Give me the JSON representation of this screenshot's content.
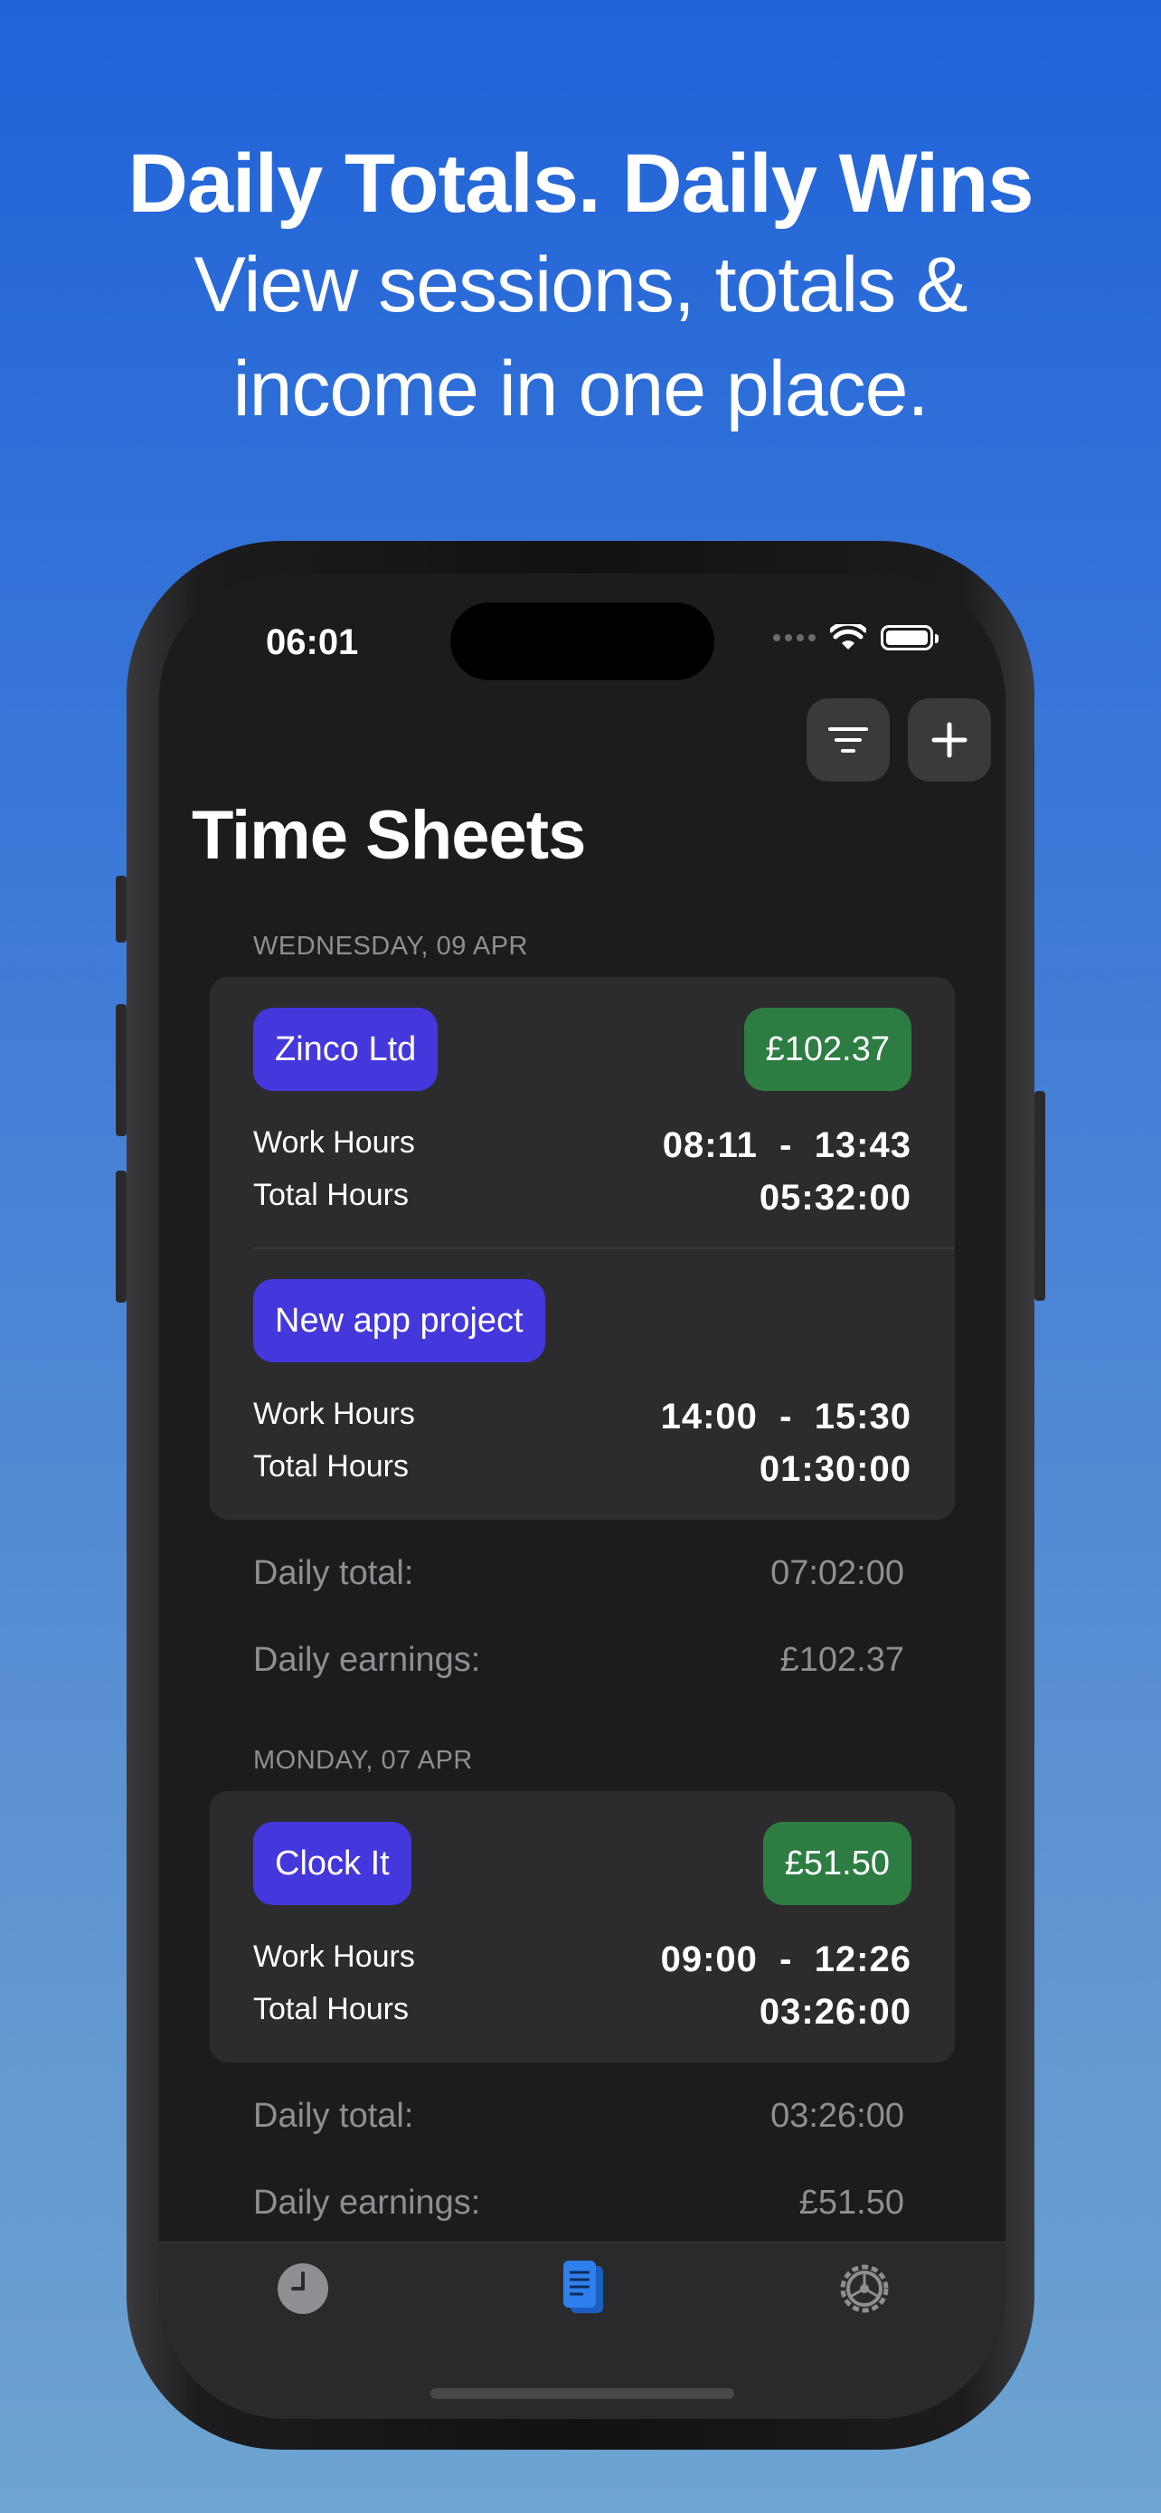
{
  "headline": {
    "line1": "Daily Totals. Daily Wins",
    "line2": "View sessions, totals &",
    "line3": "income in one place."
  },
  "status_bar": {
    "time": "06:01"
  },
  "toolbar": {
    "filter_icon": "filter-lines-icon",
    "add_icon": "plus-icon"
  },
  "page_title": "Time Sheets",
  "days": [
    {
      "header": "WEDNESDAY, 09 APR",
      "entries": [
        {
          "project": "Zinco Ltd",
          "amount": "£102.37",
          "work_label": "Work Hours",
          "work_start": "08:11",
          "work_end": "13:43",
          "total_label": "Total Hours",
          "total": "05:32:00"
        },
        {
          "project": "New app project",
          "amount": "",
          "work_label": "Work Hours",
          "work_start": "14:00",
          "work_end": "15:30",
          "total_label": "Total Hours",
          "total": "01:30:00"
        }
      ],
      "daily_total_label": "Daily total:",
      "daily_total": "07:02:00",
      "daily_earnings_label": "Daily earnings:",
      "daily_earnings": "£102.37"
    },
    {
      "header": "MONDAY, 07 APR",
      "entries": [
        {
          "project": "Clock It",
          "amount": "£51.50",
          "work_label": "Work Hours",
          "work_start": "09:00",
          "work_end": "12:26",
          "total_label": "Total Hours",
          "total": "03:26:00"
        }
      ],
      "daily_total_label": "Daily total:",
      "daily_total": "03:26:00",
      "daily_earnings_label": "Daily earnings:",
      "daily_earnings": "£51.50"
    }
  ],
  "tabs": [
    {
      "icon": "clock-icon",
      "active": false
    },
    {
      "icon": "document-icon",
      "active": true
    },
    {
      "icon": "settings-gear-icon",
      "active": false
    }
  ],
  "colors": {
    "accent": "#2f80ed",
    "chip": "#4438dc",
    "price": "#2d7d43",
    "background_dark": "#1c1c1e",
    "card": "#2c2c2e"
  }
}
